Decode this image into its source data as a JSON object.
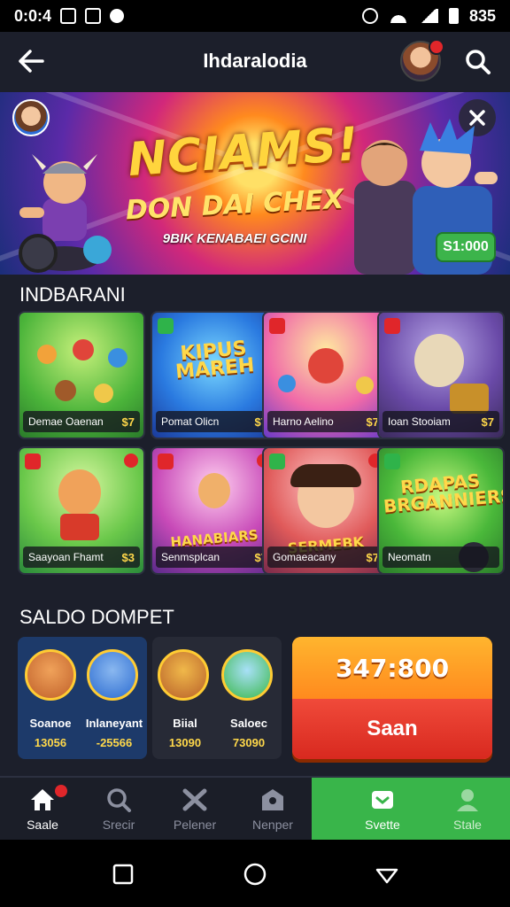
{
  "status_bar": {
    "time": "0:0:4",
    "battery_text": "835"
  },
  "header": {
    "title": "Ihdaralodia"
  },
  "banner": {
    "title": "NCIAMS!",
    "subtitle": "DON DAI CHEX",
    "tagline": "9BIK KENABAEI GCINI",
    "price": "S1:000"
  },
  "section_games": {
    "title": "INDBARANI"
  },
  "games": [
    {
      "caption": "Demae Oaenan",
      "price": "$7",
      "art_text": ""
    },
    {
      "caption": "Pomat Olicn",
      "price": "$7",
      "art_text": "KIPUS MAREH"
    },
    {
      "caption": "Harno Aelino",
      "price": "$7",
      "art_text": ""
    },
    {
      "caption": "Ioan Stooiam",
      "price": "$7",
      "art_text": ""
    },
    {
      "caption": "Saayoan Fhamt",
      "price": "$3",
      "art_text": ""
    },
    {
      "caption": "Senmsplcan",
      "price": "$7",
      "art_text": "HANABIARS"
    },
    {
      "caption": "Gomaeacany",
      "price": "$7",
      "art_text": "SERMEBK"
    },
    {
      "caption": "Neomatn",
      "price": "",
      "art_text": "RDAPAS BRGANNIERS"
    }
  ],
  "section_wallet": {
    "title": "SALDO DOMPET"
  },
  "wallet": {
    "card1": [
      {
        "name": "Soanoe",
        "value": "13056"
      },
      {
        "name": "Inlaneyant",
        "value": "-25566"
      }
    ],
    "card2": [
      {
        "name": "Biial",
        "value": "13090"
      },
      {
        "name": "Saloec",
        "value": "73090"
      }
    ],
    "balance": "347:800",
    "action": "Saan"
  },
  "bottom_nav": [
    {
      "label": "Saale"
    },
    {
      "label": "Srecir"
    },
    {
      "label": "Pelener"
    },
    {
      "label": "Nenper"
    },
    {
      "label": "Svette"
    },
    {
      "label": "Stale"
    }
  ],
  "colors": {
    "accent_green": "#39b54a",
    "accent_orange": "#ff8a1e",
    "accent_red": "#e0262a",
    "gold": "#ffd84a",
    "background": "#1c1f2b"
  }
}
